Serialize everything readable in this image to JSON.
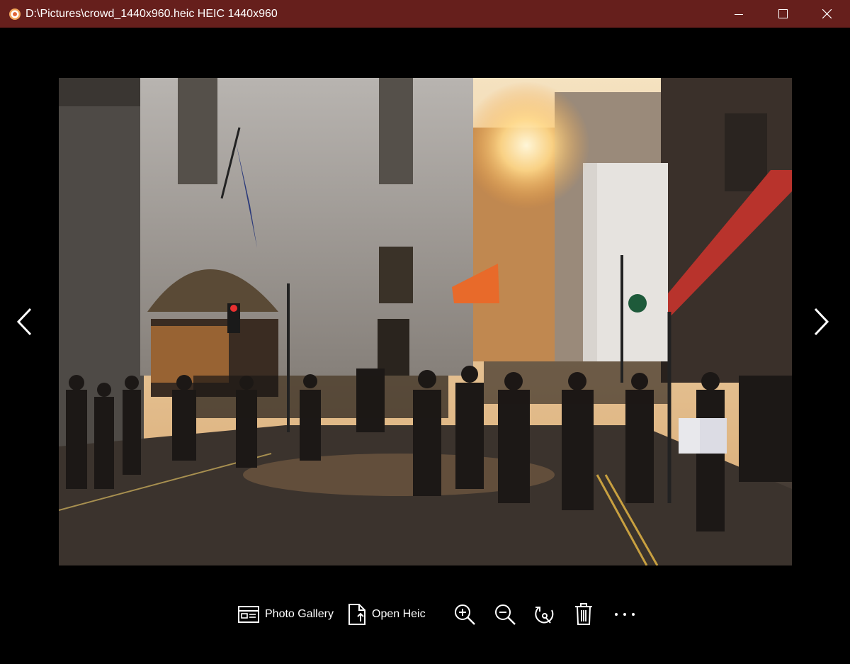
{
  "window": {
    "title": "D:\\Pictures\\crowd_1440x960.heic HEIC 1440x960",
    "icon": "app-camera-icon",
    "controls": [
      "minimize-icon",
      "maximize-icon",
      "close-icon"
    ],
    "titlebar_color": "#661f1c"
  },
  "viewer": {
    "background": "#000000",
    "image_description_icon": "street-crowd-photo",
    "nav": {
      "prev_icon": "chevron-left-icon",
      "next_icon": "chevron-right-icon"
    }
  },
  "toolbar": {
    "gallery_label": "Photo Gallery",
    "open_label": "Open Heic",
    "zoom_in_icon": "zoom-in-icon",
    "zoom_out_icon": "zoom-out-icon",
    "rotate_icon": "rotate-icon",
    "delete_icon": "trash-icon",
    "more_label": "···"
  }
}
